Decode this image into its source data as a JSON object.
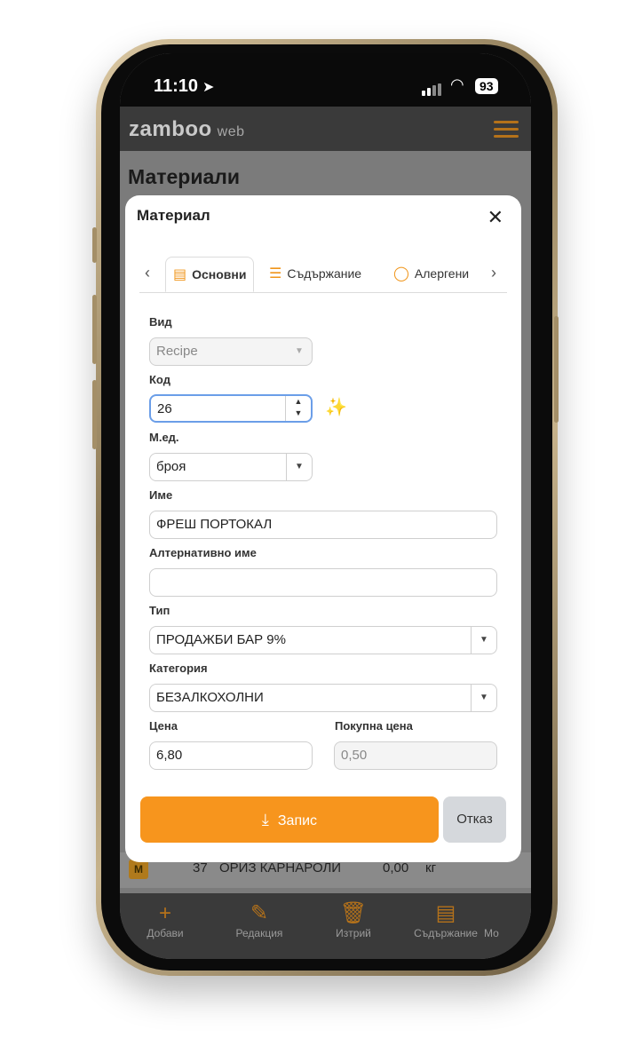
{
  "status": {
    "time": "11:10",
    "battery": "93"
  },
  "app": {
    "logo": "zamboo",
    "logo_suffix": "web",
    "page_title": "Материали"
  },
  "background_row": {
    "badge": "M",
    "number": "37",
    "name": "ОРИЗ КАРНАРОЛИ",
    "qty": "0,00",
    "unit": "кг"
  },
  "bottom_nav": [
    {
      "label": "Добави",
      "icon": "plus-icon"
    },
    {
      "label": "Редакция",
      "icon": "edit-icon"
    },
    {
      "label": "Изтрий",
      "icon": "trash-icon"
    },
    {
      "label": "Съдържание",
      "icon": "document-icon"
    },
    {
      "label": "Мо",
      "icon": "more-icon"
    }
  ],
  "modal": {
    "title": "Материал",
    "tabs": [
      {
        "label": "Основни",
        "icon": "document-icon",
        "active": true
      },
      {
        "label": "Съдържание",
        "icon": "list-icon",
        "active": false
      },
      {
        "label": "Алергени",
        "icon": "egg-icon",
        "active": false
      }
    ],
    "fields": {
      "vid": {
        "label": "Вид",
        "value": "Recipe"
      },
      "kod": {
        "label": "Код",
        "value": "26"
      },
      "med": {
        "label": "М.ед.",
        "value": "броя"
      },
      "ime": {
        "label": "Име",
        "value": "ФРЕШ ПОРТОКАЛ"
      },
      "alt_ime": {
        "label": "Алтернативно име",
        "value": ""
      },
      "tip": {
        "label": "Тип",
        "value": "ПРОДАЖБИ БАР 9%"
      },
      "kategoria": {
        "label": "Категория",
        "value": "БЕЗАЛКОХОЛНИ"
      },
      "cena": {
        "label": "Цена",
        "value": "6,80"
      },
      "pokupna_cena": {
        "label": "Покупна цена",
        "value": "0,50"
      }
    },
    "save_label": "Запис",
    "cancel_label": "Отказ"
  },
  "colors": {
    "accent": "#f7951d",
    "appbar": "#3a3a3a",
    "focus": "#6b9ee8"
  }
}
